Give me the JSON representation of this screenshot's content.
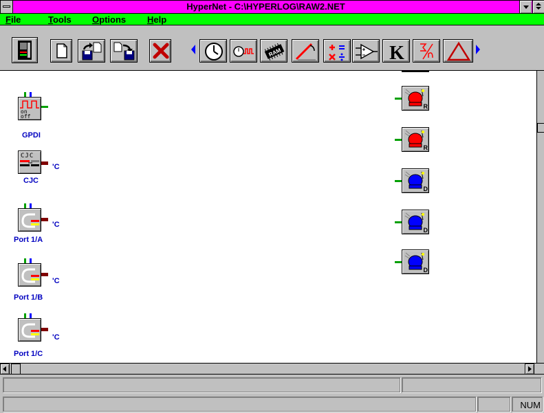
{
  "window": {
    "title": "HyperNet - C:\\HYPERLOG\\RAW2.NET"
  },
  "menu": [
    {
      "label": "File",
      "accel": "F"
    },
    {
      "label": "Tools",
      "accel": "T"
    },
    {
      "label": "Options",
      "accel": "O"
    },
    {
      "label": "Help",
      "accel": "H"
    }
  ],
  "toolbar": {
    "buttons": [
      {
        "icon": "device-panel-icon"
      },
      {
        "icon": "new-file-icon"
      },
      {
        "icon": "open-file-icon"
      },
      {
        "icon": "save-file-icon"
      },
      {
        "icon": "delete-x-icon"
      },
      {
        "icon": "clock-icon"
      },
      {
        "icon": "pulse-timer-icon"
      },
      {
        "icon": "ram-chip-icon"
      },
      {
        "icon": "probe-icon"
      },
      {
        "icon": "math-operators-icon"
      },
      {
        "icon": "amplifier-icon"
      },
      {
        "icon": "constant-k-icon"
      },
      {
        "icon": "sigma-divide-icon"
      },
      {
        "icon": "delta-triangle-icon"
      }
    ],
    "ram_text": "RAM",
    "k_text": "K"
  },
  "components": [
    {
      "label": "GPDI",
      "box_text": [
        "on",
        "off"
      ]
    },
    {
      "label": "CJC",
      "box_text": [
        "CJC"
      ],
      "unit": "'C"
    },
    {
      "label": "Port 1/A",
      "unit": "'C"
    },
    {
      "label": "Port 1/B",
      "unit": "'C"
    },
    {
      "label": "Port 1/C",
      "unit": "'C"
    }
  ],
  "alarms": [
    {
      "color": "#ff0000",
      "badge": "R"
    },
    {
      "color": "#ff0000",
      "badge": "R"
    },
    {
      "color": "#0000ff",
      "badge": "D"
    },
    {
      "color": "#0000ff",
      "badge": "D"
    },
    {
      "color": "#0000ff",
      "badge": "D"
    }
  ],
  "status": {
    "num": "NUM"
  },
  "colors": {
    "titlebar": "#ff00ff",
    "menubar": "#00ff00",
    "label": "#0000c0"
  }
}
